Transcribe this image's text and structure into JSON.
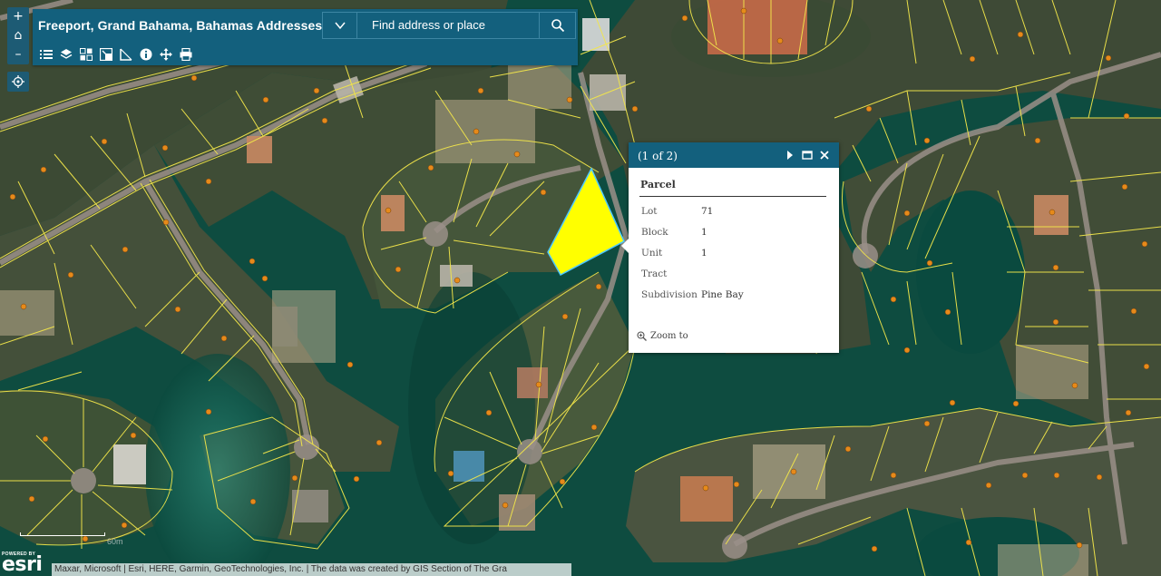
{
  "app": {
    "title": "Freeport, Grand Bahama, Bahamas Addresses"
  },
  "search": {
    "placeholder": "Find address or place"
  },
  "zoom": {
    "in_label": "+",
    "home_label": "⌂",
    "out_label": "–"
  },
  "toolbar": {
    "tools": [
      "legend-icon",
      "layers-icon",
      "basemap-gallery-icon",
      "overview-icon",
      "measure-icon",
      "about-icon",
      "share-icon",
      "print-icon"
    ]
  },
  "popup": {
    "count": "(1 of 2)",
    "title": "Parcel",
    "fields": [
      {
        "key": "Lot",
        "value": "71"
      },
      {
        "key": "Block",
        "value": "1"
      },
      {
        "key": "Unit",
        "value": "1"
      },
      {
        "key": "Tract",
        "value": ""
      },
      {
        "key": "Subdivision",
        "value": "Pine Bay"
      }
    ],
    "zoom_to": "Zoom to"
  },
  "scalebar": {
    "label": "60m"
  },
  "logo": {
    "powered_by": "POWERED BY",
    "name": "esri"
  },
  "attribution": "Maxar, Microsoft | Esri, HERE, Garmin, GeoTechnologies, Inc. | The data was created by GIS Section of The Gra",
  "colors": {
    "header": "#13607d",
    "selected_parcel": "#ffff00",
    "parcel_lines": "#f2e64a",
    "water": "#0d4a40"
  }
}
